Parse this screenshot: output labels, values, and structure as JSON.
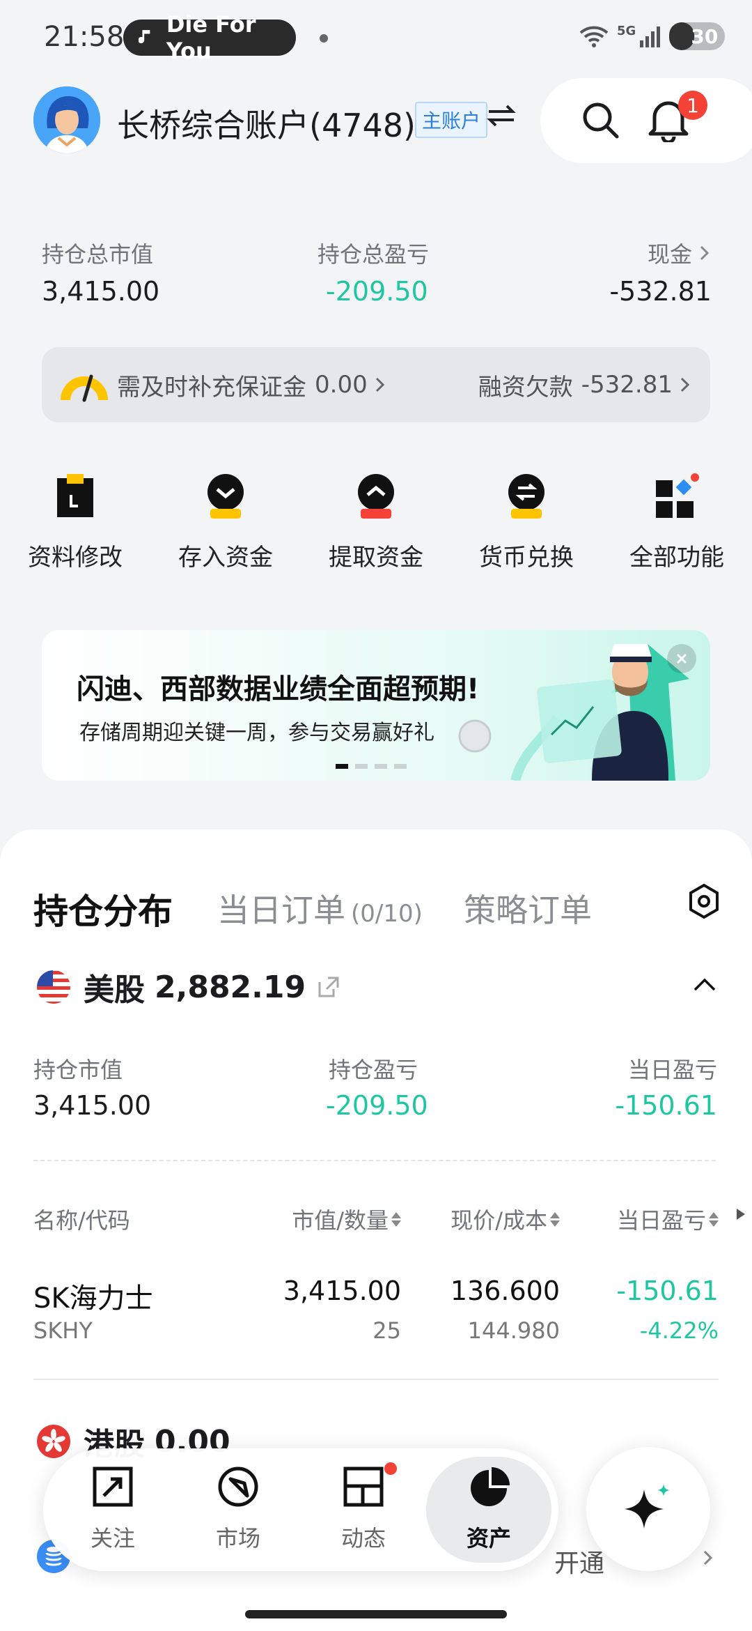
{
  "status_bar": {
    "time": "21:58",
    "now_playing": "Die For You",
    "network": "5G",
    "battery": "30"
  },
  "header": {
    "account_name": "长桥综合账户(4748)",
    "account_badge": "主账户",
    "switch_icon": "swap-icon",
    "search_icon": "search-icon",
    "bell_icon": "bell-icon",
    "notification_count": "1"
  },
  "summary": {
    "total_value_label": "持仓总市值",
    "total_value": "3,415.00",
    "total_pnl_label": "持仓总盈亏",
    "total_pnl": "-209.50",
    "cash_label": "现金",
    "cash": "-532.81"
  },
  "margin": {
    "call_label": "需及时补充保证金",
    "call_value": "0.00",
    "loan_label": "融资欠款",
    "loan_value": "-532.81"
  },
  "quick_actions": [
    {
      "label": "资料修改",
      "icon": "profile-edit-icon"
    },
    {
      "label": "存入资金",
      "icon": "deposit-icon"
    },
    {
      "label": "提取资金",
      "icon": "withdraw-icon"
    },
    {
      "label": "货币兑换",
      "icon": "currency-exchange-icon"
    },
    {
      "label": "全部功能",
      "icon": "all-functions-icon"
    }
  ],
  "banner": {
    "title": "闪迪、西部数据业绩全面超预期!",
    "subtitle": "存储周期迎关键一周，参与交易赢好礼",
    "page": 1,
    "pages": 4
  },
  "tabs": {
    "positions": "持仓分布",
    "today_orders": "当日订单",
    "today_orders_count": "(0/10)",
    "strategy_orders": "策略订单"
  },
  "us_section": {
    "market": "美股",
    "amount": "2,882.19",
    "market_value_label": "持仓市值",
    "market_value": "3,415.00",
    "pnl_label": "持仓盈亏",
    "pnl": "-209.50",
    "day_pnl_label": "当日盈亏",
    "day_pnl": "-150.61"
  },
  "table": {
    "headers": {
      "name": "名称/代码",
      "value_qty": "市值/数量",
      "price_cost": "现价/成本",
      "day_pnl": "当日盈亏"
    },
    "rows": [
      {
        "name": "SK海力士",
        "code": "SKHY",
        "market_value": "3,415.00",
        "quantity": "25",
        "price": "136.600",
        "cost": "144.980",
        "day_pnl": "-150.61",
        "day_pnl_pct": "-4.22%"
      }
    ]
  },
  "hk_section": {
    "market": "港股",
    "amount": "0.00"
  },
  "bottom_partial": {
    "text": "开通"
  },
  "bottom_nav": [
    {
      "label": "关注",
      "icon": "watchlist-icon"
    },
    {
      "label": "市场",
      "icon": "market-icon"
    },
    {
      "label": "动态",
      "icon": "feed-icon"
    },
    {
      "label": "资产",
      "icon": "assets-pie-icon"
    }
  ],
  "colors": {
    "accent_green": "#1ec6a1",
    "alert_red": "#f44336",
    "yellow": "#ffc400"
  }
}
